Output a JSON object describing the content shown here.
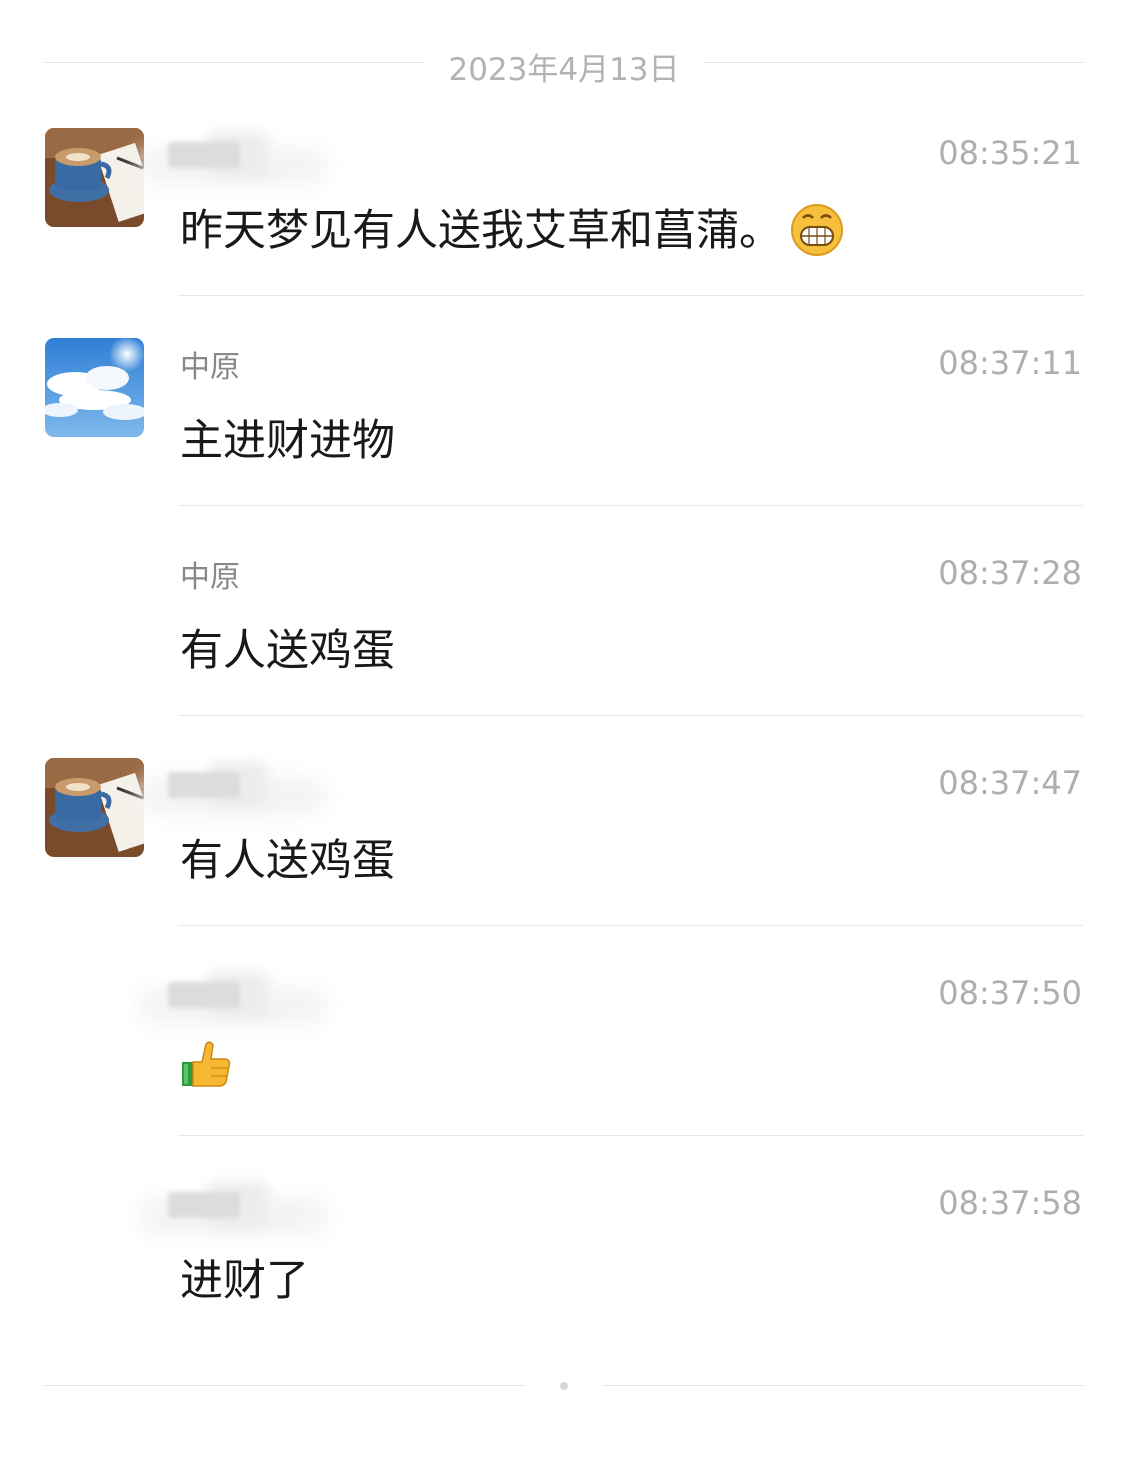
{
  "date_separator": "2023年4月13日",
  "messages": [
    {
      "sender": "",
      "time": "08:35:21",
      "text": "昨天梦见有人送我艾草和菖蒲。",
      "avatar": "coffee-avatar",
      "emoji": "grin-emoji"
    },
    {
      "sender": "中原",
      "time": "08:37:11",
      "text": "主进财进物",
      "avatar": "sky-avatar"
    },
    {
      "sender": "中原",
      "time": "08:37:28",
      "text": "有人送鸡蛋"
    },
    {
      "sender": "",
      "time": "08:37:47",
      "text": "有人送鸡蛋",
      "avatar": "coffee-avatar"
    },
    {
      "sender": "",
      "time": "08:37:50",
      "text": "",
      "emoji": "thumbs-up-emoji"
    },
    {
      "sender": "",
      "time": "08:37:58",
      "text": "进财了"
    }
  ]
}
